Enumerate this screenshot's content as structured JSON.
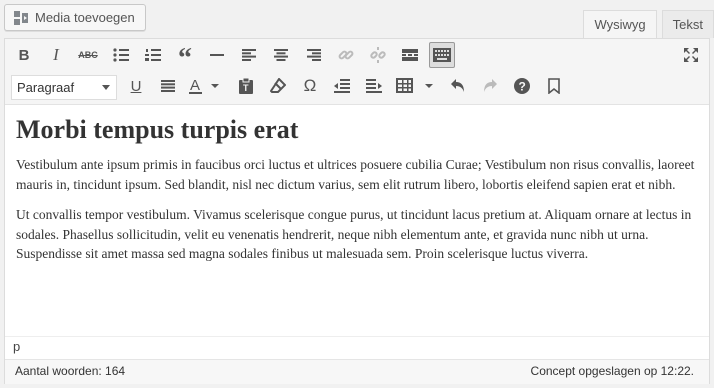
{
  "media_button": {
    "label": "Media toevoegen",
    "icon": "media-icon"
  },
  "tabs": [
    {
      "label": "Wysiwyg",
      "active": true
    },
    {
      "label": "Tekst",
      "active": false
    }
  ],
  "format_select": {
    "value": "Paragraaf"
  },
  "document": {
    "heading": "Morbi tempus turpis erat",
    "paragraphs": [
      "Vestibulum ante ipsum primis in faucibus orci luctus et ultrices posuere cubilia Curae; Vestibulum non risus convallis, laoreet mauris in, tincidunt ipsum. Sed blandit, nisl nec dictum varius, sem elit rutrum libero, lobortis eleifend sapien erat et nibh.",
      "Ut convallis tempor vestibulum. Vivamus scelerisque congue purus, ut tincidunt lacus pretium at. Aliquam ornare at lectus in sodales. Phasellus sollicitudin, velit eu venenatis hendrerit, neque nibh elementum ante, et gravida nunc nibh ut urna. Suspendisse sit amet massa sed magna sodales finibus ut malesuada sem. Proin scelerisque luctus viverra."
    ]
  },
  "path": "p",
  "status": {
    "word_count": "Aantal woorden: 164",
    "draft": "Concept opgeslagen op 12:22."
  },
  "colors": {
    "toolbar_bg": "#f5f5f5",
    "icon": "#555555",
    "disabled_icon": "#bbbbbb",
    "page_bg": "#f1f1f1"
  }
}
